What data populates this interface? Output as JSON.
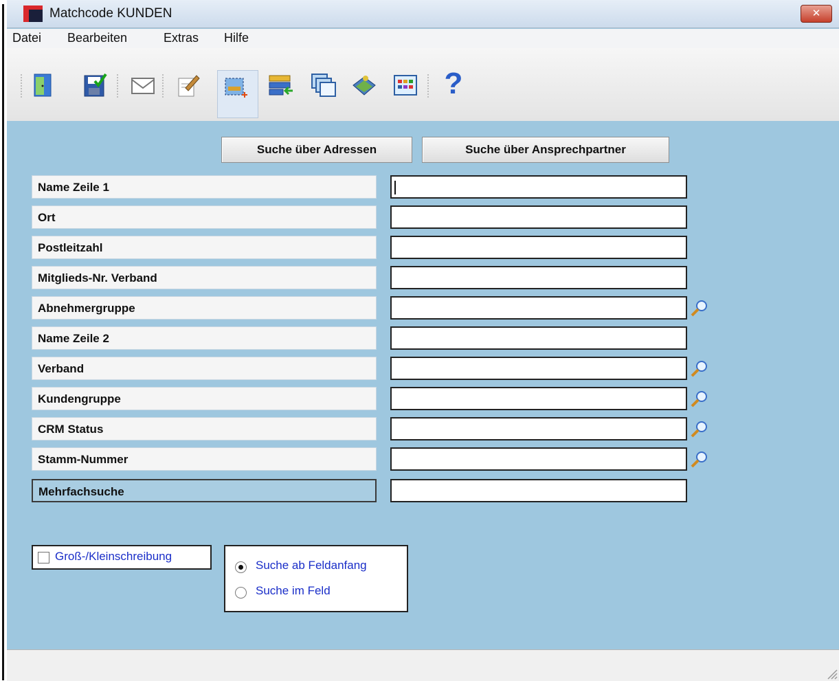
{
  "window": {
    "title": "Matchcode KUNDEN",
    "close_glyph": "✕"
  },
  "menu": {
    "items": [
      "Datei",
      "Bearbeiten",
      "Extras",
      "Hilfe"
    ]
  },
  "toolbar": {
    "icons": [
      "exit-door-icon",
      "save-icon",
      "mail-icon",
      "edit-icon",
      "new-record-icon",
      "import-icon",
      "windows-icon",
      "book-icon",
      "grid-icon",
      "help-icon"
    ],
    "help_glyph": "?"
  },
  "search_tabs": {
    "addresses": "Suche über Adressen",
    "contacts": "Suche über Ansprechpartner"
  },
  "fields": [
    {
      "label": "Name Zeile 1",
      "value": "",
      "lookup": false
    },
    {
      "label": "Ort",
      "value": "",
      "lookup": false
    },
    {
      "label": "Postleitzahl",
      "value": "",
      "lookup": false
    },
    {
      "label": "Mitglieds-Nr. Verband",
      "value": "",
      "lookup": false
    },
    {
      "label": "Abnehmergruppe",
      "value": "",
      "lookup": true
    },
    {
      "label": "Name Zeile 2",
      "value": "",
      "lookup": false
    },
    {
      "label": "Verband",
      "value": "",
      "lookup": true
    },
    {
      "label": "Kundengruppe",
      "value": "",
      "lookup": true
    },
    {
      "label": "CRM Status",
      "value": "",
      "lookup": true
    },
    {
      "label": "Stamm-Nummer",
      "value": "",
      "lookup": true
    },
    {
      "label": "Mehrfachsuche",
      "value": "",
      "lookup": false
    }
  ],
  "options": {
    "case_sensitive": {
      "label": "Groß-/Kleinschreibung",
      "checked": false
    },
    "search_mode": {
      "choices": [
        "Suche ab Feldanfang",
        "Suche im Feld"
      ],
      "selected": "Suche ab Feldanfang"
    }
  },
  "colors": {
    "background": "#9ec7df",
    "link_text": "#1a2ec8",
    "close_red": "#c6402c"
  }
}
